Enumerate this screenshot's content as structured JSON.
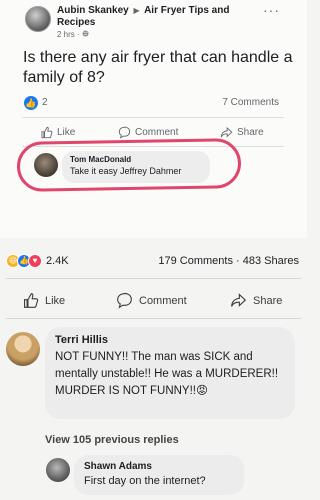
{
  "post": {
    "author": "Aubin Skankey",
    "arrow": "▶",
    "group": "Air Fryer Tips and Recipes",
    "time": "2 hrs · ",
    "globe_icon": "globe-icon",
    "more_icon": "more-dots-icon",
    "more": "···",
    "text": "Is there any air fryer that can handle a family of 8?",
    "reaction_count": "2",
    "comments_count": "7 Comments",
    "actions": {
      "like": "Like",
      "comment": "Comment",
      "share": "Share"
    }
  },
  "highlighted_comment": {
    "author": "Tom MacDonald",
    "text": "Take it easy Jeffrey Dahmer",
    "ring_color": "#e0456b"
  },
  "outer": {
    "reaction_count": "2.4K",
    "comments_shares": "179 Comments · 483 Shares",
    "actions": {
      "like": "Like",
      "comment": "Comment",
      "share": "Share"
    },
    "reaction_icons": [
      "haha-icon",
      "like-icon",
      "love-icon"
    ]
  },
  "comments": [
    {
      "author": "Terri Hillis",
      "text": "NOT FUNNY!! The man was SICK and mentally unstable!! He was a MURDERER!! MURDER IS NOT FUNNY!!😡"
    },
    {
      "author": "Shawn Adams",
      "text": "First day on the internet?"
    }
  ],
  "view_previous": "View 105 previous replies",
  "colors": {
    "like_blue": "#1877f2",
    "love_red": "#f33e58",
    "haha_yellow": "#f7b125"
  }
}
